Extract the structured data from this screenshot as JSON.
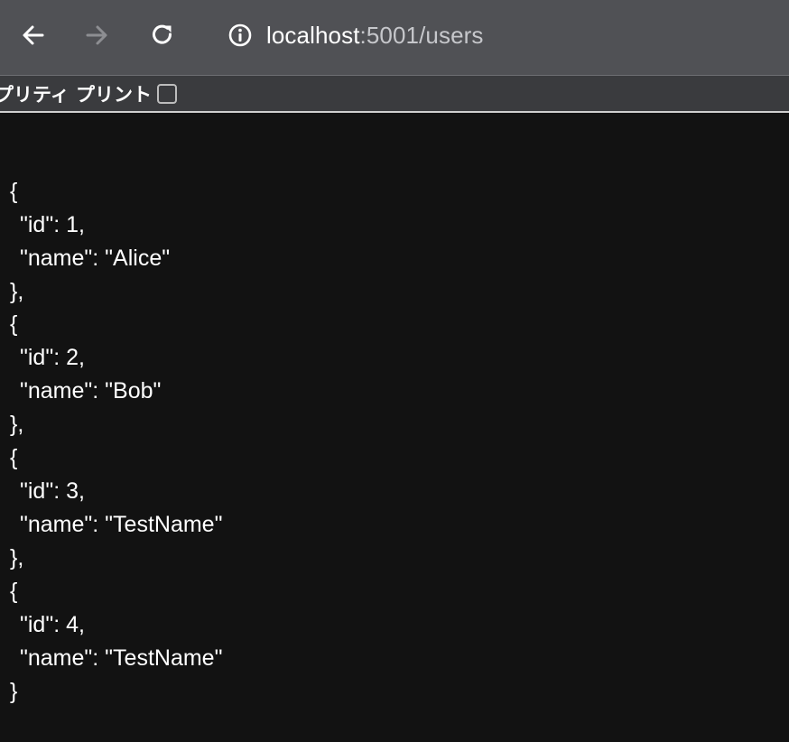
{
  "browser": {
    "url_host": "localhost",
    "url_rest": ":5001/users",
    "icons": [
      "back-arrow-icon",
      "forward-arrow-icon",
      "reload-icon",
      "info-icon"
    ]
  },
  "pretty_print": {
    "label": "プリティ プリント",
    "checked": false
  },
  "json_lines": [
    "[",
    "  {",
    "    \"id\": 1,",
    "    \"name\": \"Alice\"",
    "  },",
    "  {",
    "    \"id\": 2,",
    "    \"name\": \"Bob\"",
    "  },",
    "  {",
    "    \"id\": 3,",
    "    \"name\": \"TestName\"",
    "  },",
    "  {",
    "    \"id\": 4,",
    "    \"name\": \"TestName\"",
    "  }",
    "]"
  ]
}
